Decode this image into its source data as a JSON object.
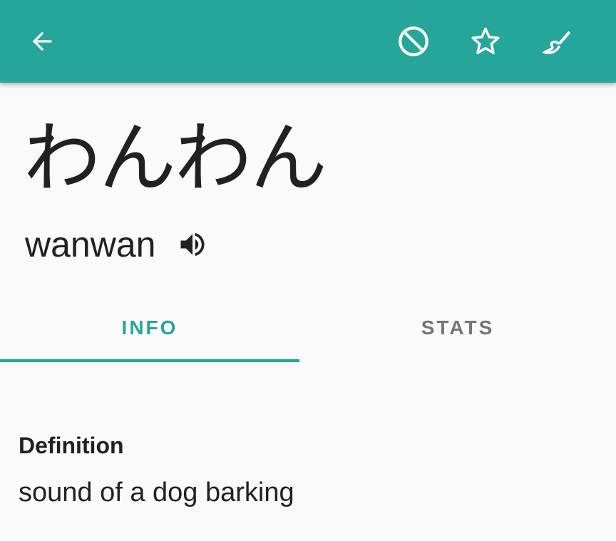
{
  "toolbar": {
    "background_color": "#26a69a",
    "icons": {
      "back": "arrow-back-icon",
      "block": "block-icon",
      "favorite": "star-outline-icon",
      "edit": "brush-icon"
    }
  },
  "word": {
    "text": "わんわん",
    "reading": "wanwan",
    "audio_icon": "volume-up-icon"
  },
  "tabs": {
    "items": [
      {
        "label": "INFO",
        "active": true
      },
      {
        "label": "STATS",
        "active": false
      }
    ],
    "active_color": "#26a69a",
    "inactive_color": "#757575"
  },
  "definition": {
    "label": "Definition",
    "text": "sound of a dog barking"
  }
}
